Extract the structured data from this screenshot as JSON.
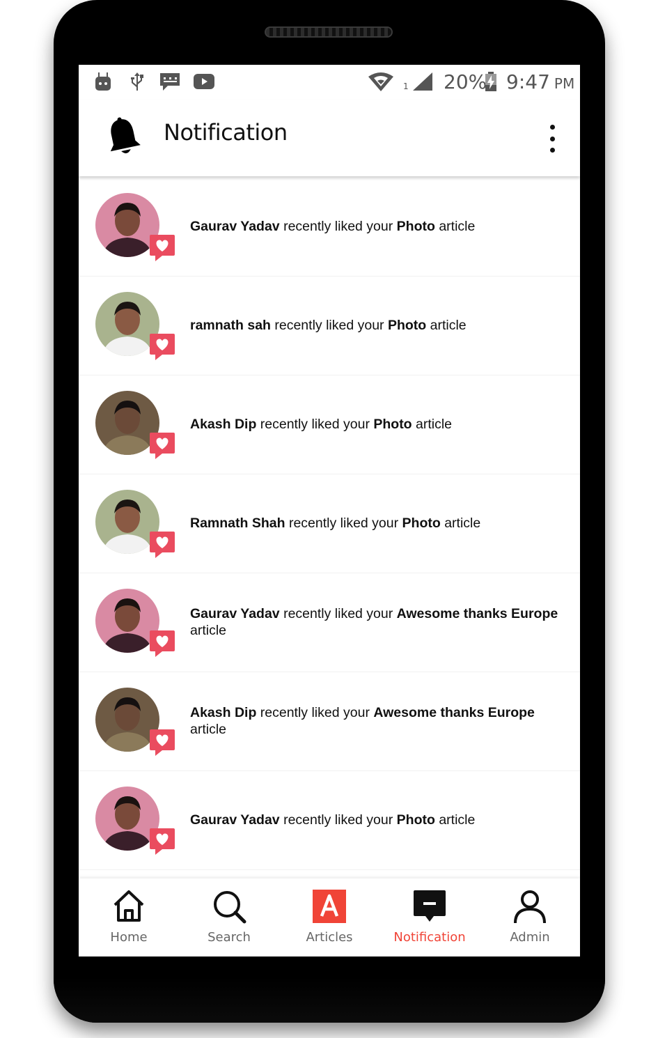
{
  "status_bar": {
    "icons": [
      "android-debug-icon",
      "usb-icon",
      "message-icon",
      "youtube-icon",
      "wifi-icon",
      "signal-icon",
      "battery-charging-icon"
    ],
    "sim_index": "1",
    "battery_percent": "20%",
    "time": "9:47",
    "ampm": "PM"
  },
  "app_bar": {
    "title": "Notification",
    "icon": "bell-icon",
    "menu_icon": "more-vertical-icon"
  },
  "notifications": [
    {
      "name": "Gaurav Yadav",
      "action": "recently liked your",
      "target": "Photo",
      "suffix": "article",
      "avatar_tone": "pink"
    },
    {
      "name": "ramnath sah",
      "action": "recently liked your",
      "target": "Photo",
      "suffix": "article",
      "avatar_tone": "green"
    },
    {
      "name": "Akash Dip",
      "action": "recently liked your",
      "target": "Photo",
      "suffix": "article",
      "avatar_tone": "brown"
    },
    {
      "name": "Ramnath Shah",
      "action": "recently liked your",
      "target": "Photo",
      "suffix": "article",
      "avatar_tone": "green"
    },
    {
      "name": "Gaurav Yadav",
      "action": "recently liked your",
      "target": "Awesome thanks Europe",
      "suffix": "article",
      "avatar_tone": "pink"
    },
    {
      "name": "Akash Dip",
      "action": "recently liked your",
      "target": "Awesome thanks Europe",
      "suffix": "article",
      "avatar_tone": "brown"
    },
    {
      "name": "Gaurav Yadav",
      "action": "recently liked your",
      "target": "Photo",
      "suffix": "article",
      "avatar_tone": "pink"
    }
  ],
  "bottom_nav": {
    "items": [
      {
        "label": "Home",
        "icon": "home-icon"
      },
      {
        "label": "Search",
        "icon": "search-icon"
      },
      {
        "label": "Articles",
        "icon": "articles-icon"
      },
      {
        "label": "Notification",
        "icon": "notification-icon",
        "active": true
      },
      {
        "label": "Admin",
        "icon": "user-icon"
      }
    ]
  },
  "colors": {
    "accent": "#f04437",
    "badge": "#ea4c5f",
    "nav_text": "#666666"
  }
}
